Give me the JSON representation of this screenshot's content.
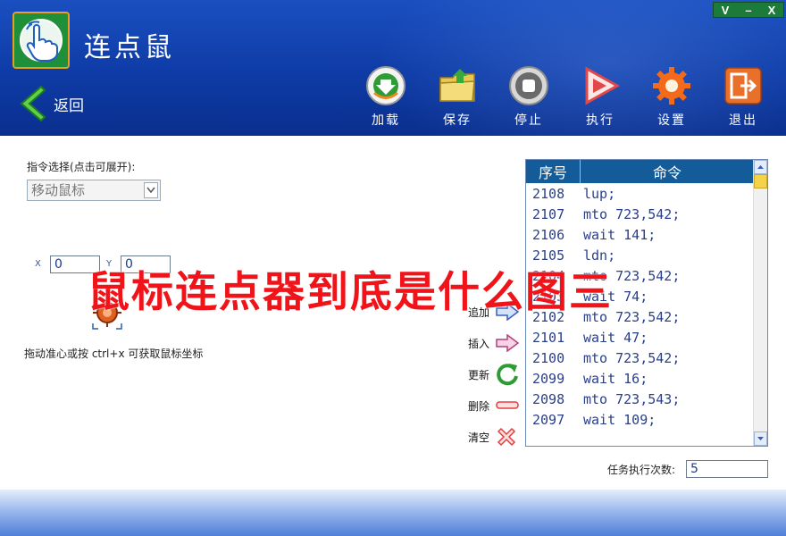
{
  "window": {
    "controls": [
      "V",
      "–",
      "X"
    ]
  },
  "app": {
    "title": "连点鼠",
    "back_label": "返回"
  },
  "toolbar": [
    {
      "label": "加载",
      "icon": "load-download-icon"
    },
    {
      "label": "保存",
      "icon": "save-folder-icon"
    },
    {
      "label": "停止",
      "icon": "stop-icon"
    },
    {
      "label": "执行",
      "icon": "play-icon"
    },
    {
      "label": "设置",
      "icon": "gear-icon"
    },
    {
      "label": "退出",
      "icon": "exit-icon"
    }
  ],
  "command": {
    "label": "指令选择(点击可展开):",
    "selected": "移动鼠标"
  },
  "coords": {
    "x_label": "X",
    "y_label": "Y",
    "x_value": "0",
    "y_value": "0",
    "hint": "拖动准心或按 ctrl+x 可获取鼠标坐标"
  },
  "actions": [
    {
      "label": "追加",
      "icon": "arrow-right-blue-icon"
    },
    {
      "label": "插入",
      "icon": "arrow-right-pink-icon"
    },
    {
      "label": "更新",
      "icon": "refresh-icon"
    },
    {
      "label": "删除",
      "icon": "minus-icon"
    },
    {
      "label": "清空",
      "icon": "clear-x-icon"
    }
  ],
  "list": {
    "headers": [
      "序号",
      "命令"
    ],
    "rows": [
      {
        "no": "2108",
        "cmd": "lup;"
      },
      {
        "no": "2107",
        "cmd": "mto 723,542;"
      },
      {
        "no": "2106",
        "cmd": "wait 141;"
      },
      {
        "no": "2105",
        "cmd": "ldn;"
      },
      {
        "no": "2104",
        "cmd": "mto 723,542;"
      },
      {
        "no": "2103",
        "cmd": "wait 74;"
      },
      {
        "no": "2102",
        "cmd": "mto 723,542;"
      },
      {
        "no": "2101",
        "cmd": "wait 47;"
      },
      {
        "no": "2100",
        "cmd": "mto 723,542;"
      },
      {
        "no": "2099",
        "cmd": "wait 16;"
      },
      {
        "no": "2098",
        "cmd": "mto 723,543;"
      },
      {
        "no": "2097",
        "cmd": "wait 109;"
      }
    ]
  },
  "task": {
    "label": "任务执行次数:",
    "value": "5"
  },
  "overlay_text": "鼠标连点器到底是什么图三",
  "colors": {
    "header_blue": "#0e3ba6",
    "list_header": "#135c99",
    "overlay_red": "#f0141a"
  }
}
